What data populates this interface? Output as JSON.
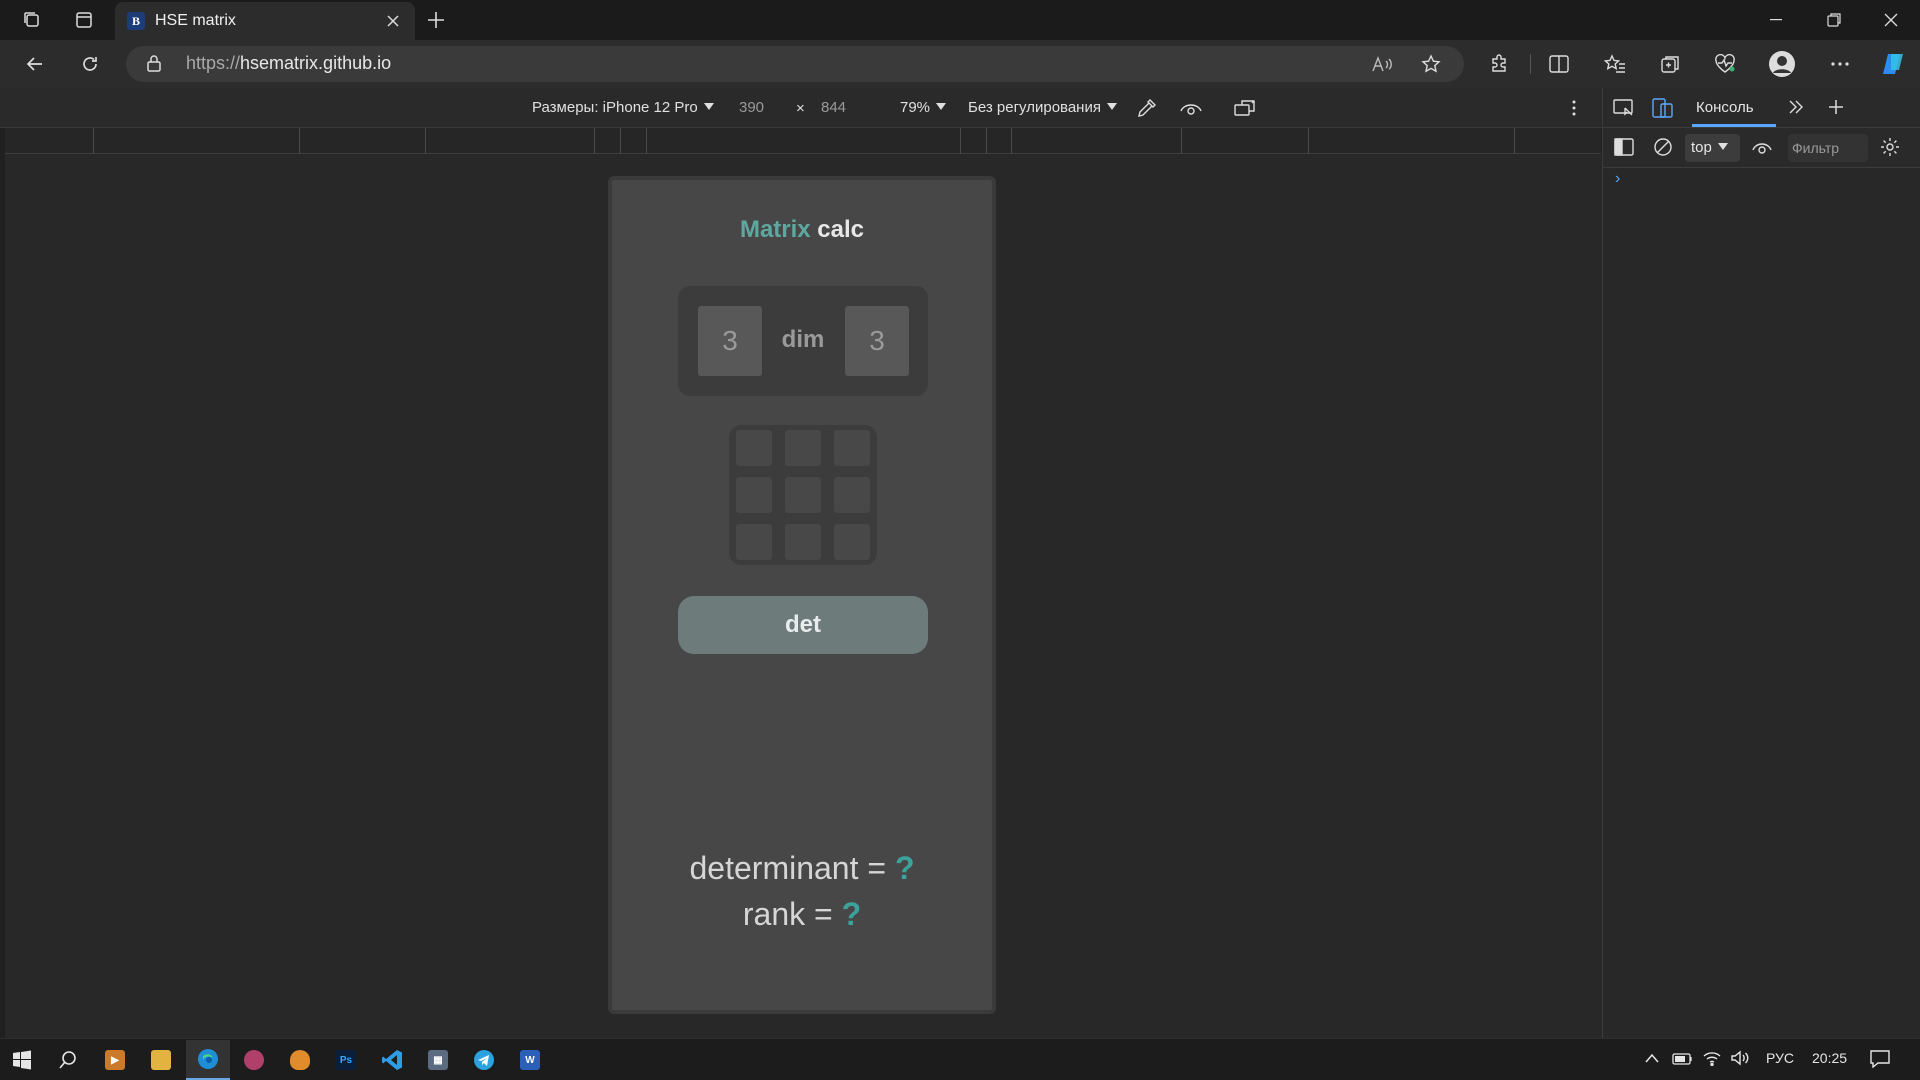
{
  "browser": {
    "tab_title": "HSE matrix",
    "tab_favicon_letter": "В",
    "url_protocol": "https://",
    "url_host": "hsematrix.github.io"
  },
  "devtools": {
    "device_label": "Размеры: iPhone 12 Pro",
    "width": "390",
    "times": "×",
    "height": "844",
    "zoom": "79%",
    "throttle": "Без регулирования",
    "console_tab": "Консоль",
    "context": "top",
    "filter_placeholder": "Фильтр",
    "prompt": "›"
  },
  "app": {
    "title_accent": "Matrix",
    "title_rest": " calc",
    "rows": "3",
    "dim_label": "dim",
    "cols": "3",
    "det_button": "det",
    "determinant_label": "determinant = ",
    "determinant_value": "?",
    "rank_label": "rank = ",
    "rank_value": "?"
  },
  "taskbar": {
    "lang": "РУС",
    "time": "20:25"
  },
  "colors": {
    "accent_teal": "#3ba39c",
    "title_teal": "#5fa8a0",
    "button": "#6d7c7a",
    "devtools_blue": "#5aa7ff"
  }
}
